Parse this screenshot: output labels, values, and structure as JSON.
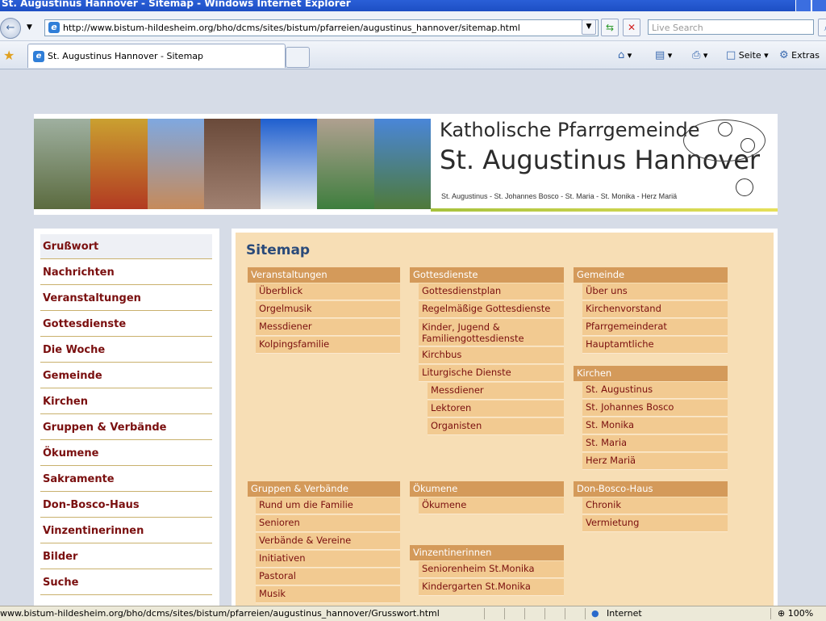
{
  "window": {
    "title": "St. Augustinus Hannover - Sitemap - Windows Internet Explorer"
  },
  "address": {
    "url": "http://www.bistum-hildesheim.org/bho/dcms/sites/bistum/pfarreien/augustinus_hannover/sitemap.html",
    "search_placeholder": "Live Search"
  },
  "tab": {
    "title": "St. Augustinus Hannover - Sitemap"
  },
  "commands": {
    "page": "Seite",
    "tools": "Extras"
  },
  "banner": {
    "title_line1": "Katholische Pfarrgemeinde",
    "title_line2": "St. Augustinus Hannover",
    "subtitle": "St. Augustinus - St. Johannes Bosco - St. Maria - St. Monika - Herz Mariä"
  },
  "sidebar": {
    "items": [
      {
        "label": "Grußwort"
      },
      {
        "label": "Nachrichten"
      },
      {
        "label": "Veranstaltungen"
      },
      {
        "label": "Gottesdienste"
      },
      {
        "label": "Die Woche"
      },
      {
        "label": "Gemeinde"
      },
      {
        "label": "Kirchen"
      },
      {
        "label": "Gruppen & Verbände"
      },
      {
        "label": "Ökumene"
      },
      {
        "label": "Sakramente"
      },
      {
        "label": "Don-Bosco-Haus"
      },
      {
        "label": "Vinzentinerinnen"
      },
      {
        "label": "Bilder"
      },
      {
        "label": "Suche"
      }
    ]
  },
  "sitemap": {
    "title": "Sitemap",
    "sections": [
      {
        "heading": "Veranstaltungen",
        "items": [
          {
            "label": "Überblick"
          },
          {
            "label": "Orgelmusik"
          },
          {
            "label": "Messdiener"
          },
          {
            "label": "Kolpingsfamilie"
          }
        ]
      },
      {
        "heading": "Gottesdienste",
        "items": [
          {
            "label": "Gottesdienstplan"
          },
          {
            "label": "Regelmäßige Gottesdienste"
          },
          {
            "label": "Kinder, Jugend & Familiengottesdienste"
          },
          {
            "label": "Kirchbus"
          },
          {
            "label": "Liturgische Dienste"
          },
          {
            "label": "Messdiener"
          },
          {
            "label": "Lektoren"
          },
          {
            "label": "Organisten"
          }
        ]
      },
      {
        "heading": "Gemeinde",
        "items": [
          {
            "label": "Über uns"
          },
          {
            "label": "Kirchenvorstand"
          },
          {
            "label": "Pfarrgemeinderat"
          },
          {
            "label": "Hauptamtliche"
          }
        ]
      },
      {
        "heading": "Kirchen",
        "items": [
          {
            "label": "St. Augustinus"
          },
          {
            "label": "St. Johannes Bosco"
          },
          {
            "label": "St. Monika"
          },
          {
            "label": "St. Maria"
          },
          {
            "label": "Herz Mariä"
          }
        ]
      },
      {
        "heading": "Gruppen & Verbände",
        "items": [
          {
            "label": "Rund um die Familie"
          },
          {
            "label": "Senioren"
          },
          {
            "label": "Verbände & Vereine"
          },
          {
            "label": "Initiativen"
          },
          {
            "label": "Pastoral"
          },
          {
            "label": "Musik"
          }
        ]
      },
      {
        "heading": "Ökumene",
        "items": [
          {
            "label": "Ökumene"
          }
        ]
      },
      {
        "heading": "Vinzentinerinnen",
        "items": [
          {
            "label": "Seniorenheim St.Monika"
          },
          {
            "label": "Kindergarten St.Monika"
          }
        ]
      },
      {
        "heading": "Don-Bosco-Haus",
        "items": [
          {
            "label": "Chronik"
          },
          {
            "label": "Vermietung"
          }
        ]
      }
    ]
  },
  "status": {
    "text": "www.bistum-hildesheim.org/bho/dcms/sites/bistum/pfarreien/augustinus_hannover/Grusswort.html",
    "zone": "Internet",
    "zoom": "100%"
  },
  "colors": {
    "link": "#7a0f0f",
    "section_header": "#d49a5a",
    "section_item": "#f2ca91",
    "content_bg": "#f7deb5",
    "title": "#2a4a7a"
  }
}
